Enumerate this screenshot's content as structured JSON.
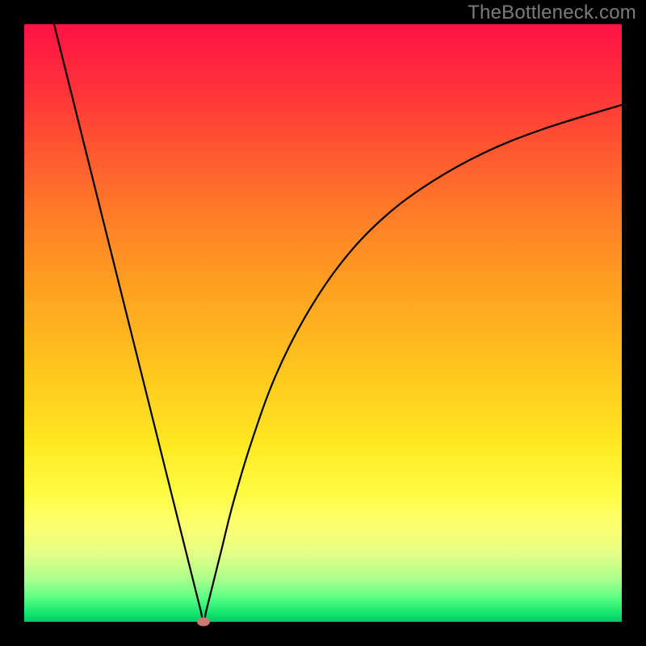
{
  "attribution": "TheBottleneck.com",
  "chart_data": {
    "type": "line",
    "title": "",
    "xlabel": "",
    "ylabel": "",
    "xlim": [
      0,
      100
    ],
    "ylim": [
      0,
      100
    ],
    "grid": false,
    "legend": false,
    "background_gradient": {
      "direction": "vertical",
      "stops": [
        {
          "pos": 0.0,
          "color": "#ff1244",
          "meaning": "high"
        },
        {
          "pos": 0.5,
          "color": "#ffc61e",
          "meaning": "mid"
        },
        {
          "pos": 1.0,
          "color": "#00c966",
          "meaning": "low"
        }
      ]
    },
    "minimum_point": {
      "x": 30,
      "y": 0,
      "color": "#cc7a70"
    },
    "series": [
      {
        "name": "curve",
        "color": "#000000",
        "x": [
          5,
          7.5,
          10,
          12.5,
          15,
          17.5,
          20,
          22.5,
          25,
          27,
          28.5,
          29.5,
          30,
          30.5,
          31.5,
          33,
          35,
          38,
          42,
          47,
          53,
          60,
          68,
          77,
          87,
          100
        ],
        "y": [
          100,
          90,
          80,
          70,
          60,
          50,
          40,
          30,
          20,
          12,
          6,
          2,
          0,
          2,
          6,
          12,
          20,
          30,
          41,
          51,
          60,
          67.5,
          73.5,
          78.5,
          82.5,
          86.5
        ]
      }
    ]
  }
}
